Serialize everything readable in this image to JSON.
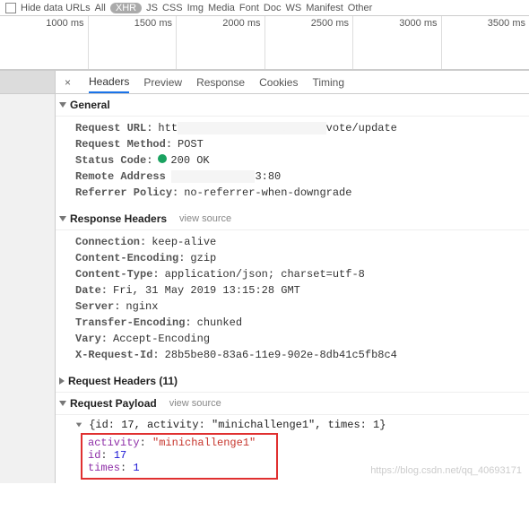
{
  "filter": {
    "hide_data_urls": "Hide data URLs",
    "items": [
      "All",
      "XHR",
      "JS",
      "CSS",
      "Img",
      "Media",
      "Font",
      "Doc",
      "WS",
      "Manifest",
      "Other"
    ],
    "active_index": 1
  },
  "timeline": {
    "ticks": [
      "1000 ms",
      "1500 ms",
      "2000 ms",
      "2500 ms",
      "3000 ms",
      "3500 ms"
    ]
  },
  "tabs": {
    "close": "×",
    "items": [
      "Headers",
      "Preview",
      "Response",
      "Cookies",
      "Timing"
    ],
    "active_index": 0
  },
  "general": {
    "title": "General",
    "request_url_label": "Request URL:",
    "request_url_prefix": "htt",
    "request_url_suffix": "vote/update",
    "request_method_label": "Request Method:",
    "request_method": "POST",
    "status_code_label": "Status Code:",
    "status_code": "200 OK",
    "remote_addr_label": "Remote Address",
    "remote_addr_suffix": "3:80",
    "referrer_label": "Referrer Policy:",
    "referrer": "no-referrer-when-downgrade"
  },
  "response_headers": {
    "title": "Response Headers",
    "view_source": "view source",
    "rows": {
      "connection_k": "Connection:",
      "connection_v": "keep-alive",
      "encoding_k": "Content-Encoding:",
      "encoding_v": "gzip",
      "ctype_k": "Content-Type:",
      "ctype_v": "application/json; charset=utf-8",
      "date_k": "Date:",
      "date_v": "Fri, 31 May 2019 13:15:28 GMT",
      "server_k": "Server:",
      "server_v": "nginx",
      "tenc_k": "Transfer-Encoding:",
      "tenc_v": "chunked",
      "vary_k": "Vary:",
      "vary_v": "Accept-Encoding",
      "xreq_k": "X-Request-Id:",
      "xreq_v": "28b5be80-83a6-11e9-902e-8db41c5fb8c4"
    }
  },
  "request_headers": {
    "title": "Request Headers (11)"
  },
  "request_payload": {
    "title": "Request Payload",
    "view_source": "view source",
    "summary": "{id: 17, activity: \"minichallenge1\", times: 1}",
    "activity_key": "activity",
    "activity_val": "\"minichallenge1\"",
    "id_key": "id",
    "id_val": "17",
    "times_key": "times",
    "times_val": "1"
  },
  "watermark": "https://blog.csdn.net/qq_40693171"
}
